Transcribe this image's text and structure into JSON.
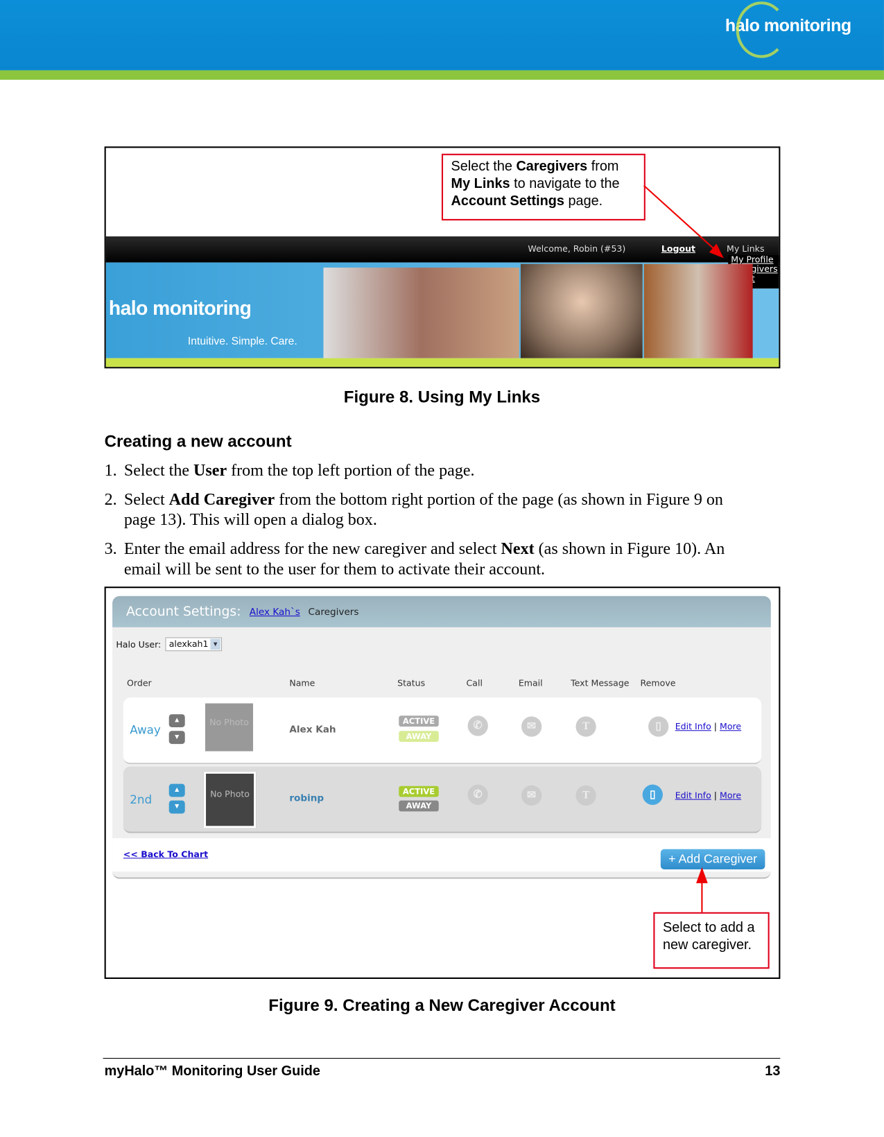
{
  "header": {
    "logo": "halo monitoring",
    "colors": {
      "blue": "#0c8fd8",
      "green": "#8cc63f"
    }
  },
  "figure8": {
    "callout": {
      "p1": "Select the ",
      "b1": "Caregivers",
      "p2": " from",
      "b2": "My Links",
      "p3": " to navigate to the",
      "b3": "Account Settings",
      "p4": " page."
    },
    "welcome": "Welcome, Robin (#53)",
    "logout": "Logout",
    "my_links": "My Links",
    "links": [
      "My Profile",
      "Caregivers",
      "Chart"
    ],
    "logo": "halo monitoring",
    "tagline": "Intuitive. Simple. Care.",
    "caption": "Figure 8. Using My Links"
  },
  "section": {
    "heading": "Creating a new account",
    "steps": [
      {
        "n": "1.",
        "a": "Select the ",
        "b": "User",
        "c": " from the top left portion of the page."
      },
      {
        "n": "2.",
        "a": "Select ",
        "b": "Add Caregiver",
        "c": " from the bottom right portion of the page (as shown in Figure 9 on page 13). This will open a dialog box."
      },
      {
        "n": "3.",
        "a": "Enter the email address for the new caregiver and select ",
        "b": "Next",
        "c": " (as shown in Figure 10). An email will be sent to the user for them to activate their account."
      }
    ]
  },
  "figure9": {
    "title": "Account Settings:",
    "user_link": "Alex Kah`s",
    "title_suffix": "Caregivers",
    "halo_user_label": "Halo User:",
    "halo_user_value": "alexkah1",
    "columns": [
      "Order",
      "Name",
      "Status",
      "Call",
      "Email",
      "Text Message",
      "Remove"
    ],
    "rows": [
      {
        "order": "Away",
        "photo": "No Photo",
        "name": "Alex Kah",
        "active": "ACTIVE",
        "away": "AWAY",
        "edit": "Edit Info",
        "more": "More"
      },
      {
        "order": "2nd",
        "photo": "No Photo",
        "name": "robinp",
        "active": "ACTIVE",
        "away": "AWAY",
        "edit": "Edit Info",
        "more": "More"
      }
    ],
    "back": "<< Back To Chart",
    "add": "+ Add Caregiver",
    "callout": "Select to add a new caregiver.",
    "caption": "Figure 9. Creating a New Caregiver Account"
  },
  "footer": {
    "title": "myHalo™ Monitoring User Guide",
    "page": "13"
  }
}
